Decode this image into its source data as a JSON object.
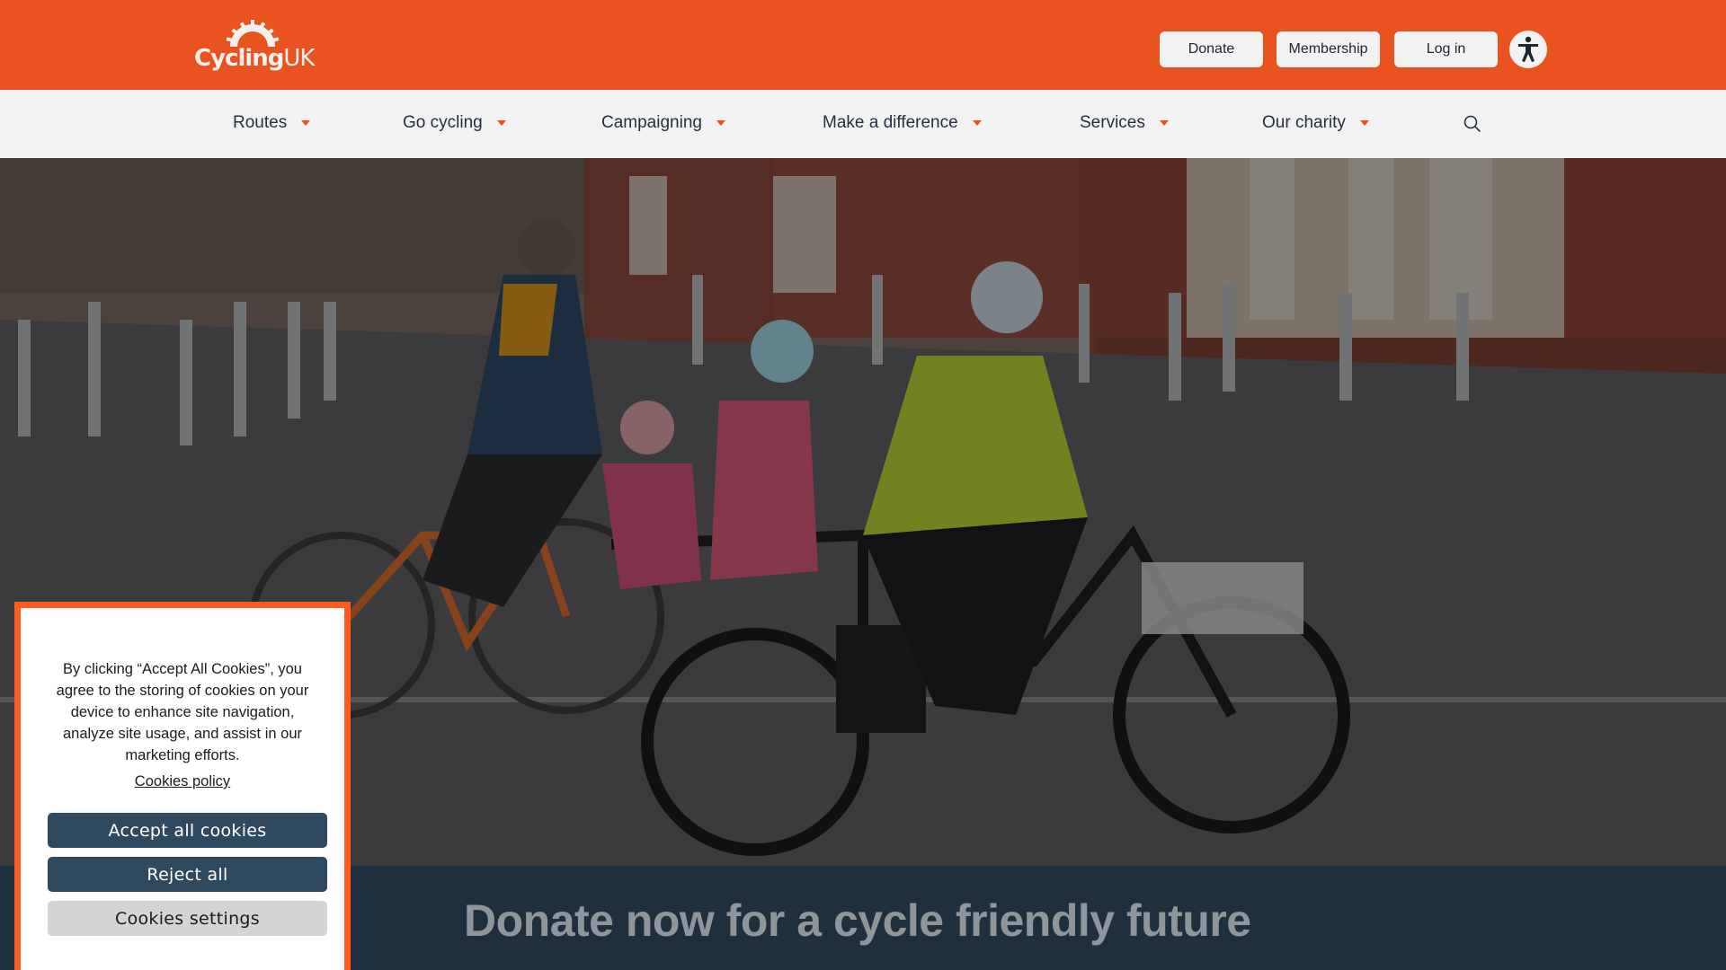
{
  "brand": {
    "logo_text_main": "Cycling",
    "logo_text_suffix": "UK",
    "primary_color": "#e8531f"
  },
  "header": {
    "donate_label": "Donate",
    "membership_label": "Membership",
    "login_label": "Log in",
    "accessibility_icon": "accessibility-person-icon"
  },
  "nav": {
    "items": [
      {
        "label": "Routes"
      },
      {
        "label": "Go cycling"
      },
      {
        "label": "Campaigning"
      },
      {
        "label": "Make a difference"
      },
      {
        "label": "Services"
      },
      {
        "label": "Our charity"
      }
    ],
    "search_icon": "search-icon"
  },
  "hero": {
    "image_subject": "family-riding-cargo-bikes"
  },
  "band": {
    "title": "Donate now for a cycle friendly future",
    "background": "#1f2f3d"
  },
  "cookie": {
    "message": "By clicking “Accept All Cookies”, you agree to the storing of cookies on your device to enhance site navigation, analyze site usage, and assist in our marketing efforts.",
    "policy_link": "Cookies policy",
    "accept_label": "Accept all cookies",
    "reject_label": "Reject all",
    "settings_label": "Cookies settings",
    "border_color": "#ff5a1f",
    "button_color": "#2f4a5f"
  }
}
